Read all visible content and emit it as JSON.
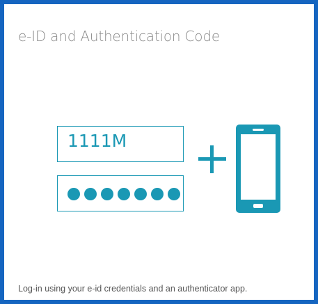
{
  "card": {
    "title": "e-ID and Authentication Code",
    "footer": "Log-in using your e-id credentials and an authenticator app."
  },
  "illustration": {
    "id_field_value": "1111M",
    "pin_mask_dot_count": 7,
    "join_symbol": "+",
    "device_icon": "smartphone-icon"
  },
  "colors": {
    "border_accent": "#1565c0",
    "icon_teal": "#1a98b4",
    "title_gray": "#8a8a8a",
    "footer_text": "#555555"
  }
}
